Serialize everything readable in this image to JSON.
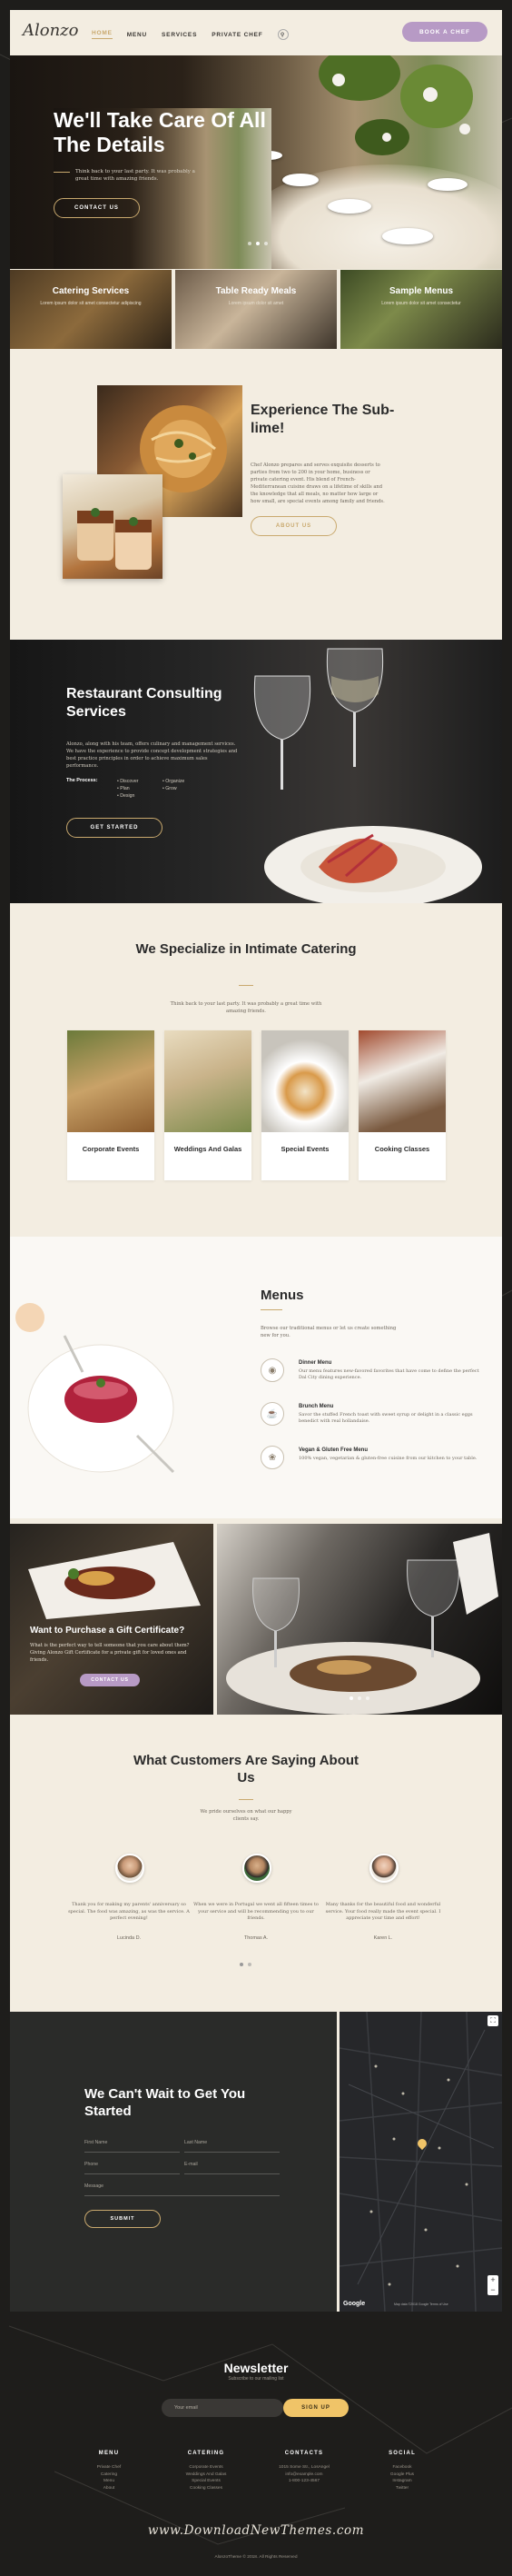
{
  "header": {
    "logo": "Alonzo",
    "nav": [
      "HOME",
      "MENU",
      "SERVICES",
      "PRIVATE CHEF"
    ],
    "search_icon": "search-icon",
    "book_label": "BOOK A CHEF"
  },
  "hero": {
    "title": "We'll Take Care Of All The Details",
    "quote": "Think back to your last party. It was probably a great time with amazing friends.",
    "cta": "CONTACT US"
  },
  "tiles": [
    {
      "title": "Catering Services",
      "desc": "Lorem ipsum dolor sit amet consectetur adipiscing"
    },
    {
      "title": "Table Ready Meals",
      "desc": "Lorem ipsum dolor sit amet"
    },
    {
      "title": "Sample Menus",
      "desc": "Lorem ipsum dolor sit amet consectetur"
    }
  ],
  "experience": {
    "title": "Experience The Sub-lime!",
    "text": "Chef Alonzo prepares and serves exquisite desserts to parties from two to 200 in your home, business or private catering event. His blend of French-Mediterranean cuisine draws on a lifetime of skills and the knowledge that all meals, no matter how large or how small, are special events among family and friends.",
    "cta": "ABOUT US"
  },
  "consulting": {
    "title": "Restaurant Consulting Services",
    "text": "Alonzo, along with his team, offers culinary and management services. We have the experience to provide concept development strategies and best practice principles in order to achieve maximum sales performance.",
    "process_label": "The Process:",
    "process_col1": [
      "Discover",
      "Plan",
      "Design"
    ],
    "process_col2": [
      "Organize",
      "Grow"
    ],
    "cta": "GET STARTED"
  },
  "specialize": {
    "title": "We Specialize in Intimate Catering",
    "text": "Think back to your last party. It was probably a great time with amazing friends.",
    "cards": [
      "Corporate Events",
      "Weddings And Galas",
      "Special Events",
      "Cooking Classes"
    ]
  },
  "menus": {
    "title": "Menus",
    "text": "Browse our traditional menus or let us create something new for you.",
    "items": [
      {
        "icon": "dinner-icon",
        "title": "Dinner Menu",
        "desc": "Our menu features new-favored favorites that have come to define the perfect Dal City dining experience."
      },
      {
        "icon": "brunch-icon",
        "title": "Brunch Menu",
        "desc": "Savor the stuffed French toast with sweet syrup or delight in a classic eggs benedict with real hollandaise."
      },
      {
        "icon": "vegan-icon",
        "title": "Vegan & Gluten Free Menu",
        "desc": "100% vegan, vegetarian & gluten-free cuisine from our kitchen to your table."
      }
    ]
  },
  "gift": {
    "title": "Want to Purchase a Gift Certificate?",
    "text": "What is the perfect way to tell someone that you care about them? Giving Alonzo Gift Certificate for a private gift for loved ones and friends.",
    "cta": "CONTACT US"
  },
  "testimonials": {
    "title": "What Customers Are Saying About Us",
    "text": "We pride ourselves on what our happy clients say.",
    "items": [
      {
        "quote": "Thank you for making my parents' anniversary so special. The food was amazing, as was the service. A perfect evening!",
        "name": "Lucinda D."
      },
      {
        "quote": "When we were in Portugal we went all fifteen times to your service and will be recommending you to our friends.",
        "name": "Thomas A."
      },
      {
        "quote": "Many thanks for the beautiful food and wonderful service. Your food really made the event special. I appreciate your time and effort!",
        "name": "Karen L."
      }
    ]
  },
  "contact": {
    "title": "We Can't Wait to Get You Started",
    "fields": [
      "First Name",
      "Last Name",
      "Phone",
      "E-mail",
      "Message"
    ],
    "submit": "SUBMIT",
    "map_brand": "Google",
    "map_footer": "Map data ©2018 Google  Terms of Use"
  },
  "newsletter": {
    "title": "Newsletter",
    "subtitle": "Subscribe to our mailing list",
    "placeholder": "Your email",
    "cta": "SIGN UP"
  },
  "footer": {
    "cols": [
      {
        "head": "MENU",
        "items": [
          "Private Chef",
          "Catering",
          "Menu",
          "About"
        ]
      },
      {
        "head": "CATERING",
        "items": [
          "Corporate Events",
          "Weddings And Galas",
          "Special Events",
          "Cooking Classes"
        ]
      },
      {
        "head": "CONTACTS",
        "items": [
          "1015 Some Str., LosAngel",
          "info@example.com",
          "1-800-123-4567"
        ]
      },
      {
        "head": "SOCIAL",
        "items": [
          "Facebook",
          "Google Plus",
          "Instagram",
          "Twitter"
        ]
      }
    ],
    "watermark": "www.DownloadNewThemes.com",
    "copyright": "AlonzoTheme © 2018. All Rights Reserved"
  },
  "colors": {
    "accent_gold": "#c9a96e",
    "accent_lilac": "#b79ac5",
    "cream": "#f3ede1",
    "dark": "#1e1d1b"
  }
}
